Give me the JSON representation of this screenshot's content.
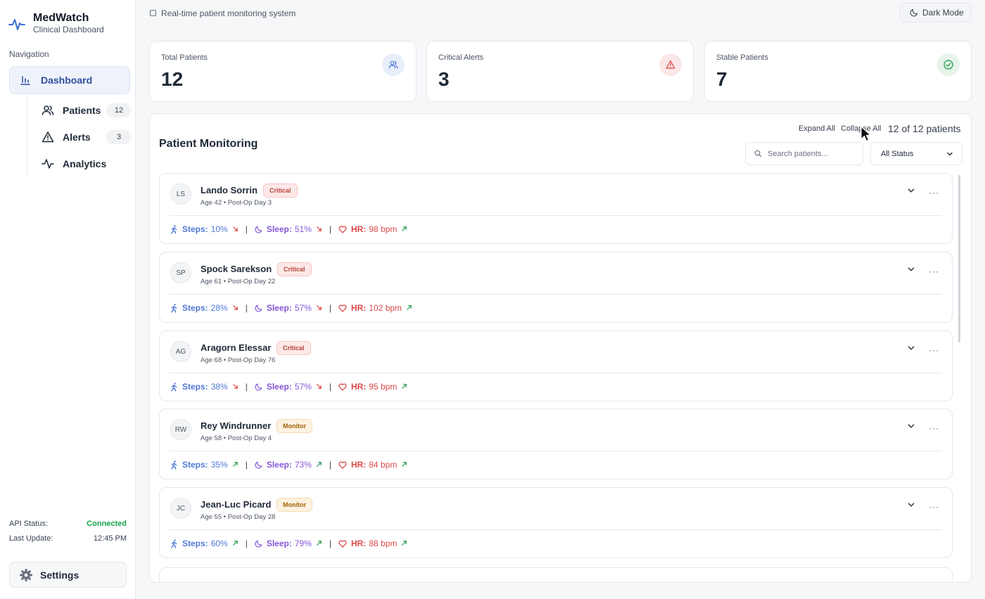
{
  "app": {
    "name": "MedWatch",
    "subtitle": "Clinical Dashboard"
  },
  "sidebar": {
    "nav_heading": "Navigation",
    "dashboard_label": "Dashboard",
    "items": [
      {
        "label": "Patients",
        "count": "12",
        "icon": "users-icon"
      },
      {
        "label": "Alerts",
        "count": "3",
        "icon": "warning-icon"
      },
      {
        "label": "Analytics",
        "icon": "activity-icon"
      }
    ],
    "api_status_label": "API Status:",
    "api_status_value": "Connected",
    "last_update_label": "Last Update:",
    "last_update_value": "12:45 PM",
    "settings_label": "Settings"
  },
  "topbar": {
    "system_text": "Real-time patient monitoring system",
    "dark_mode_label": "Dark Mode"
  },
  "stats": [
    {
      "title": "Total Patients",
      "value": "12",
      "icon": "users-icon",
      "color": "#4f78d6"
    },
    {
      "title": "Critical Alerts",
      "value": "3",
      "icon": "warning-icon",
      "color": "#dc4a4a"
    },
    {
      "title": "Stable Patients",
      "value": "7",
      "icon": "check-circle-icon",
      "color": "#2f9e55"
    }
  ],
  "monitoring": {
    "title": "Patient Monitoring",
    "expand_all": "Expand All",
    "collapse_all": "Collapse All",
    "count_text": "12 of 12 patients",
    "search_placeholder": "Search patients...",
    "status_filter": "All Status",
    "patients": [
      {
        "initials": "LS",
        "name": "Lando Sorrin",
        "status": "Critical",
        "sub": "Age 42 • Post-Op Day 3",
        "steps": "10%",
        "steps_trend": "down",
        "sleep": "51%",
        "sleep_trend": "down",
        "hr": "98 bpm",
        "hr_trend": "up"
      },
      {
        "initials": "SP",
        "name": "Spock Sarekson",
        "status": "Critical",
        "sub": "Age 61 • Post-Op Day 22",
        "steps": "28%",
        "steps_trend": "down",
        "sleep": "57%",
        "sleep_trend": "down",
        "hr": "102 bpm",
        "hr_trend": "up"
      },
      {
        "initials": "AG",
        "name": "Aragorn Elessar",
        "status": "Critical",
        "sub": "Age 68 • Post-Op Day 76",
        "steps": "38%",
        "steps_trend": "down",
        "sleep": "57%",
        "sleep_trend": "down",
        "hr": "95 bpm",
        "hr_trend": "up"
      },
      {
        "initials": "RW",
        "name": "Rey Windrunner",
        "status": "Monitor",
        "sub": "Age 58 • Post-Op Day 4",
        "steps": "35%",
        "steps_trend": "up",
        "sleep": "73%",
        "sleep_trend": "up",
        "hr": "84 bpm",
        "hr_trend": "up"
      },
      {
        "initials": "JC",
        "name": "Jean-Luc Picard",
        "status": "Monitor",
        "sub": "Age 55 • Post-Op Day 28",
        "steps": "60%",
        "steps_trend": "up",
        "sleep": "79%",
        "sleep_trend": "up",
        "hr": "88 bpm",
        "hr_trend": "up"
      }
    ],
    "labels": {
      "steps": "Steps:",
      "sleep": "Sleep:",
      "hr": "HR:"
    }
  }
}
